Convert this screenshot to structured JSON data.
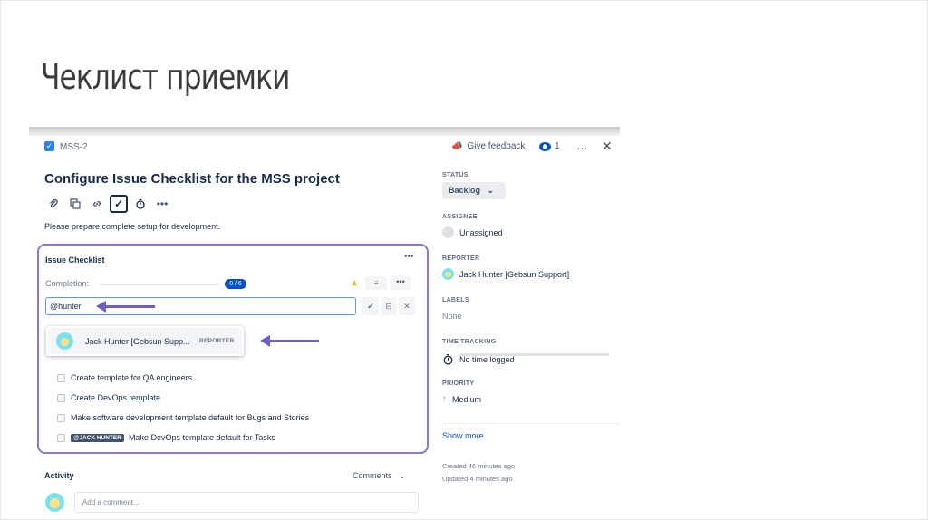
{
  "slide": {
    "title": "Чеклист приемки"
  },
  "topbar": {
    "issue_key": "MSS-2",
    "feedback_label": "Give feedback",
    "watch_count": "1",
    "more_icon": "…",
    "close_icon": "✕"
  },
  "issue": {
    "title": "Configure Issue Checklist for the MSS project",
    "toolbar_icons": [
      "attachment-icon",
      "child-issues-icon",
      "link-icon",
      "checklist-icon",
      "timer-icon",
      "more-icon"
    ],
    "description": "Please prepare complete setup for development."
  },
  "checklist": {
    "title": "Issue Checklist",
    "completion_label": "Completion:",
    "completion_badge": "0 / 6",
    "input_value": "@hunter",
    "suggestion": {
      "name": "Jack Hunter [Gebsun Supp...",
      "role": "REPORTER"
    },
    "items": [
      {
        "text": "Create template for QA engineers"
      },
      {
        "text": "Create DevOps template"
      },
      {
        "text": "Make software development template default for Bugs and Stories"
      },
      {
        "text": "Make DevOps template default for Tasks",
        "mention": "@JACK HUNTER"
      }
    ]
  },
  "activity": {
    "title": "Activity",
    "filter_label": "Comments",
    "comment_placeholder": "Add a comment..."
  },
  "sidebar": {
    "status_label": "STATUS",
    "status_value": "Backlog",
    "assignee_label": "ASSIGNEE",
    "assignee_value": "Unassigned",
    "reporter_label": "REPORTER",
    "reporter_value": "Jack Hunter [Gebsun Support]",
    "labels_label": "LABELS",
    "labels_value": "None",
    "time_label": "TIME TRACKING",
    "time_value": "No time logged",
    "priority_label": "PRIORITY",
    "priority_value": "Medium",
    "show_more": "Show more",
    "created": "Created 46 minutes ago",
    "updated": "Updated 4 minutes ago"
  },
  "colors": {
    "accent": "#0052cc",
    "highlight_border": "#8777d9",
    "arrow": "#6b5fcf"
  }
}
